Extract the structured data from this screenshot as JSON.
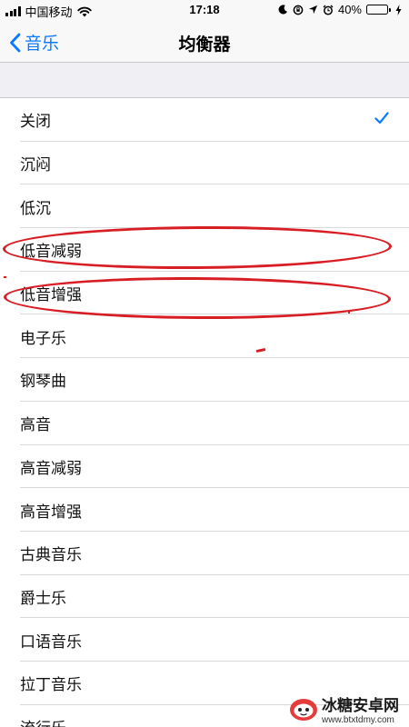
{
  "status_bar": {
    "carrier": "中国移动",
    "time": "17:18",
    "battery_percent": "40%",
    "battery_level": 0.4
  },
  "nav": {
    "back_label": "音乐",
    "title": "均衡器"
  },
  "list": {
    "items": [
      {
        "label": "关闭",
        "selected": true
      },
      {
        "label": "沉闷"
      },
      {
        "label": "低沉"
      },
      {
        "label": "低音减弱",
        "annotated": true
      },
      {
        "label": "低音增强",
        "annotated": true
      },
      {
        "label": "电子乐"
      },
      {
        "label": "钢琴曲"
      },
      {
        "label": "高音"
      },
      {
        "label": "高音减弱"
      },
      {
        "label": "高音增强"
      },
      {
        "label": "古典音乐"
      },
      {
        "label": "爵士乐"
      },
      {
        "label": "口语音乐"
      },
      {
        "label": "拉丁音乐"
      },
      {
        "label": "流行乐"
      }
    ]
  },
  "watermark": {
    "name": "冰糖安卓网",
    "url": "www.btxtdmy.com"
  },
  "colors": {
    "accent": "#0a7aff",
    "annotation": "#d81e25",
    "background": "#efeff4"
  }
}
